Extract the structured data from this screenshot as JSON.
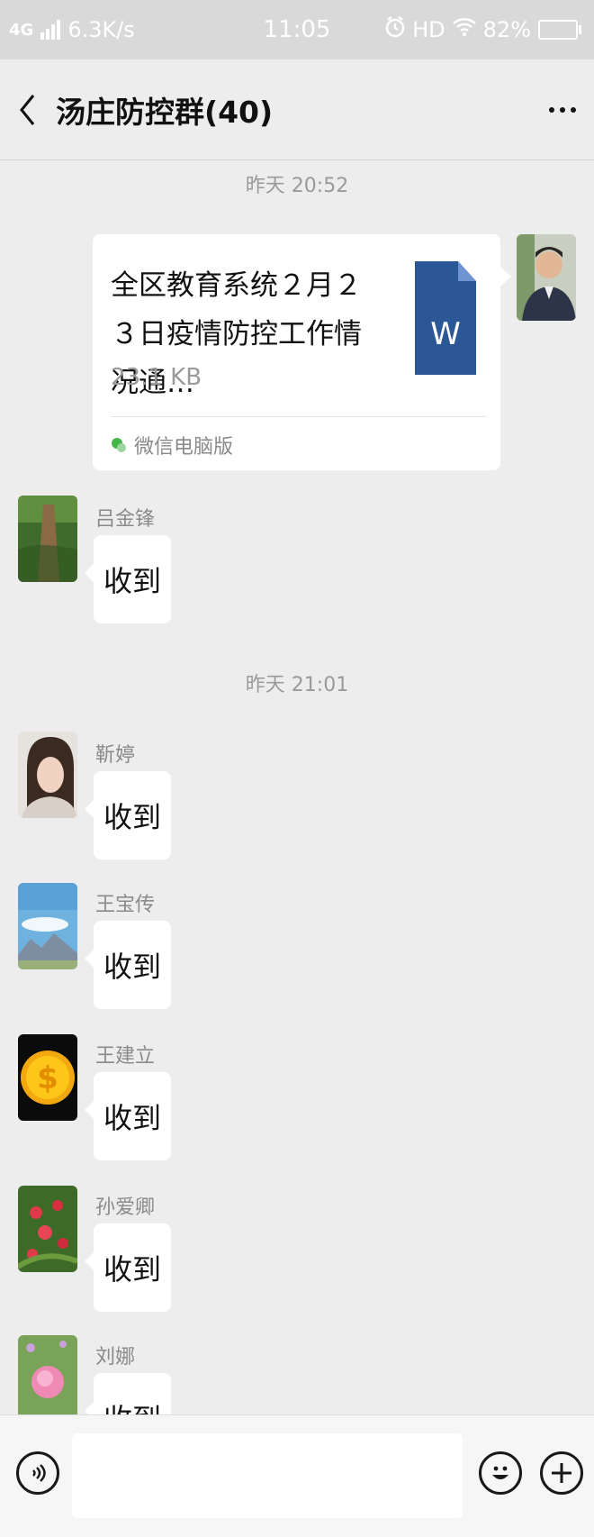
{
  "status_bar": {
    "network": "4G",
    "speed": "6.3K/s",
    "time": "11:05",
    "hd": "HD",
    "battery": "82%",
    "battery_level": 0.82
  },
  "header": {
    "title": "汤庄防控群(40)"
  },
  "timestamps": [
    "昨天 20:52",
    "昨天 21:01"
  ],
  "file_message": {
    "file_name": "全区教育系统２月２３日疫情防控工作情况通…",
    "file_size": "23.1 KB",
    "source": "微信电脑版",
    "file_type_letter": "W"
  },
  "messages": [
    {
      "sender": "吕金锋",
      "text": "收到"
    },
    {
      "sender": "靳婷",
      "text": "收到"
    },
    {
      "sender": "王宝传",
      "text": "收到"
    },
    {
      "sender": "王建立",
      "text": "收到"
    },
    {
      "sender": "孙爱卿",
      "text": "收到"
    },
    {
      "sender": "刘娜",
      "text": "收到"
    }
  ],
  "colors": {
    "background": "#ededed",
    "bubble": "#ffffff",
    "word_blue": "#2b5797",
    "wechat_green": "#44b549"
  }
}
